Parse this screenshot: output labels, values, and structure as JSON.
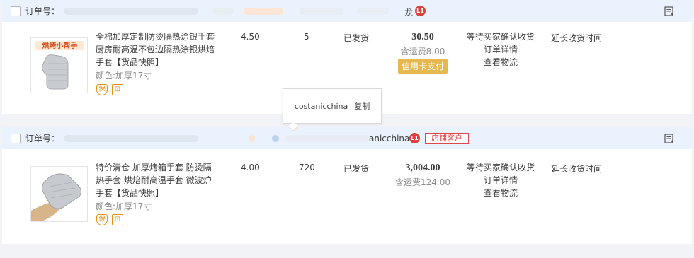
{
  "orders": [
    {
      "order_no_label": "订单号：",
      "shop_name_partial": "龙",
      "level_badge": "L1",
      "product": {
        "title": "全棉加厚定制防烫隔热涂银手套厨房耐高温不包边隔热涂银烘焙手套",
        "snapshot_link": "【货品快照】",
        "spec": "颜色:加厚17寸",
        "thumb_banner": "烘烤小帮手",
        "service_icons": [
          "shield-badge-icon",
          "camera-badge-icon"
        ],
        "service_labels": [
          "保",
          "⊡"
        ]
      },
      "unit_price": "4.50",
      "quantity": "5",
      "ship_status": "已发货",
      "total": "30.50",
      "shipping_fee": "含运费8.00",
      "payment_badge": "信用卡支付",
      "status_lines": [
        "等待买家确认收货",
        "订单详情",
        "查看物流"
      ],
      "action": "延长收货时间"
    },
    {
      "order_no_label": "订单号：",
      "shop_name_partial": "anicchina",
      "level_badge": "L1",
      "customer_tag": "店铺客户",
      "product": {
        "title": "特价清仓 加厚烤箱手套 防烫隔热手套 烘焙耐高温手套 微波炉手套",
        "snapshot_link": "【货品快照】",
        "spec": "颜色:加厚17寸",
        "service_icons": [
          "shield-badge-icon",
          "camera-badge-icon"
        ],
        "service_labels": [
          "保",
          "⊡"
        ]
      },
      "unit_price": "4.00",
      "quantity": "720",
      "ship_status": "已发货",
      "total": "3,004.00",
      "shipping_fee": "含运费124.00",
      "status_lines": [
        "等待买家确认收货",
        "订单详情",
        "查看物流"
      ],
      "action": "延长收货时间"
    }
  ],
  "tooltip": {
    "buyer_name": "costanicchina",
    "copy_label": "复制"
  },
  "colors": {
    "header_bg": "#eaf2fd",
    "accent_orange": "#e78f1a",
    "badge_red": "#d6443b",
    "credit_badge": "#e6b84e",
    "page_bg": "#f2f3f7"
  }
}
